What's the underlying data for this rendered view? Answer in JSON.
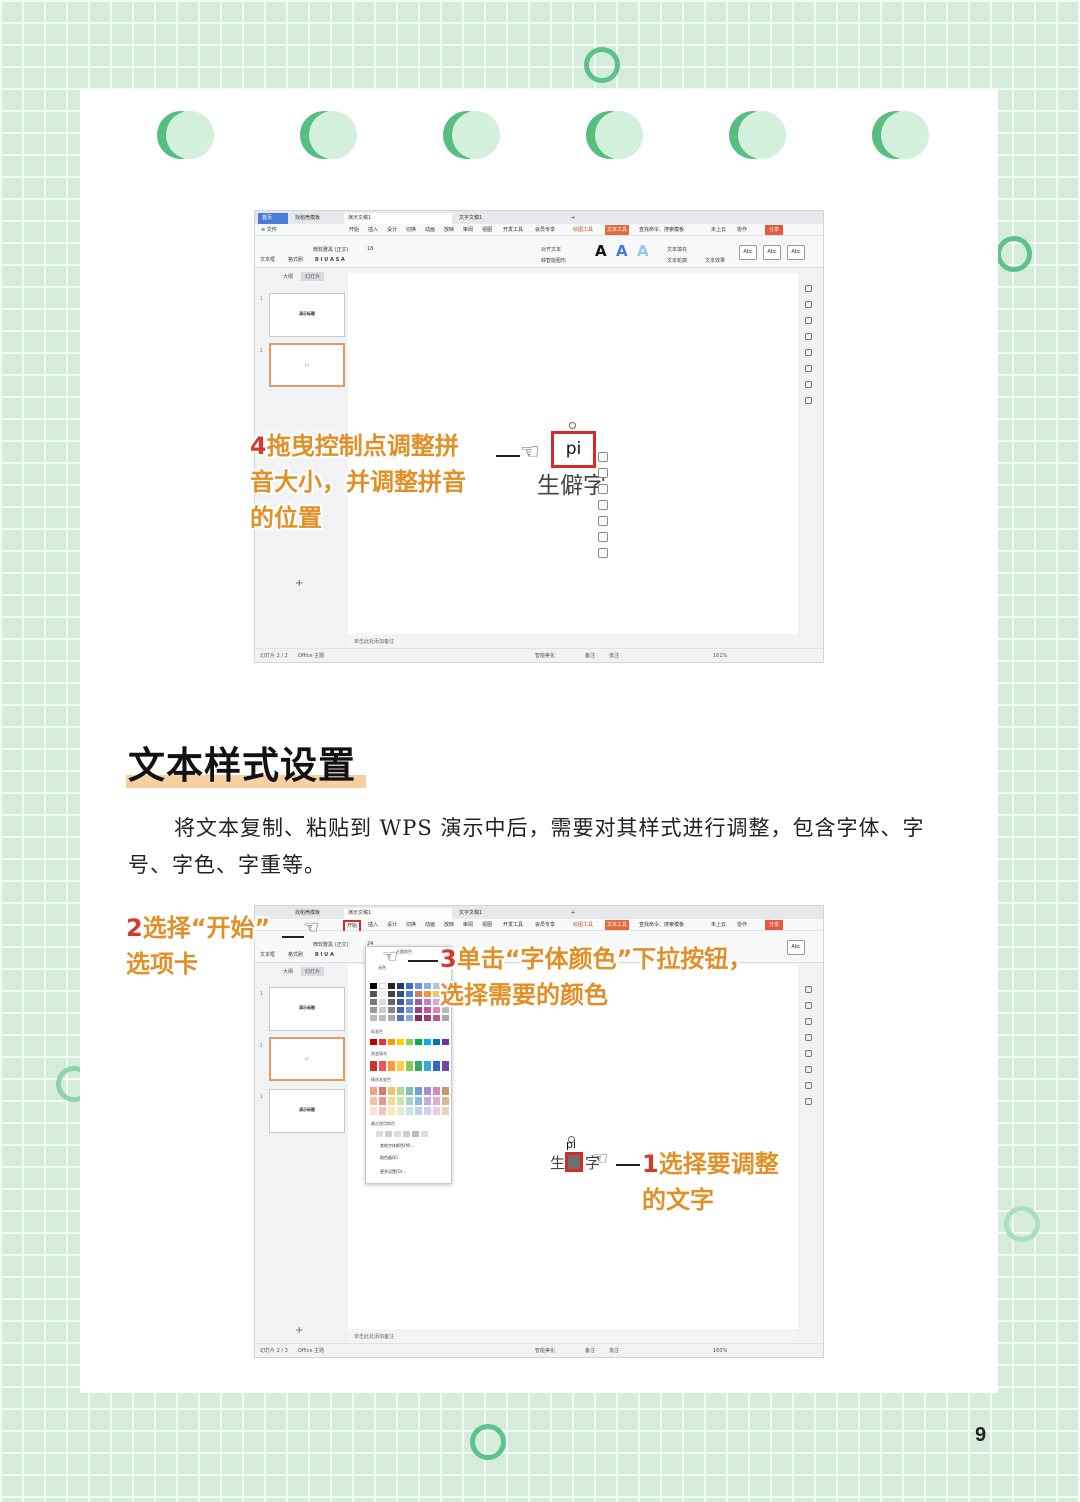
{
  "page_number": "9",
  "section": {
    "heading": "文本样式设置",
    "body": "将文本复制、粘贴到 WPS 演示中后，需要对其样式进行调整，包含字体、字号、字色、字重等。"
  },
  "colors": {
    "background": "#d4ecd9",
    "accent_green": "#5cc38c",
    "annotation_orange": "#e19028",
    "annotation_number_red": "#d33a2c",
    "highlight_red": "#d62a2a",
    "heading_underline": "#f7cfa1"
  },
  "screenshot1": {
    "tabs": [
      "首页",
      "找稻壳模板",
      "演示文稿1",
      "文字文稿1",
      "+"
    ],
    "menu": [
      "≡ 文件",
      "开始",
      "插入",
      "设计",
      "切换",
      "动画",
      "放映",
      "审阅",
      "视图",
      "开发工具",
      "会员专享",
      "绘图工具",
      "文本工具",
      "查找命令、搜索模板",
      "未上云",
      "协作",
      "分享"
    ],
    "ribbon": {
      "textbox": "文本框",
      "format_painter": "格式刷",
      "font_name": "微软雅黑 (正文)",
      "font_size": "18",
      "align_text": "对齐文本",
      "smart_shape": "转智能图形",
      "text_fill": "文本填充",
      "text_outline": "文本轮廓",
      "text_effect": "文本效果",
      "style_sample": "Abc"
    },
    "pane_tabs": [
      "大纲",
      "幻灯片"
    ],
    "slides": [
      {
        "num": "1",
        "title": "演示标题"
      },
      {
        "num": "2",
        "title": "pi"
      }
    ],
    "pinyin": "pi",
    "hanzi": "生僻字",
    "notes": "单击此处添加备注",
    "status": {
      "slide_count": "幻灯片 2 / 2",
      "theme": "Office 主题",
      "beautify": "智能美化",
      "notes_btn": "备注",
      "comments": "批注",
      "zoom": "161%"
    },
    "annotation": {
      "number": "4",
      "line1": "拖曳控制点调整拼",
      "line2": "音大小，并调整拼音",
      "line3": "的位置"
    }
  },
  "screenshot2": {
    "tabs": [
      "找稻壳模板",
      "演示文稿1",
      "文字文稿1",
      "+"
    ],
    "menu": [
      "开始",
      "插入",
      "设计",
      "切换",
      "动画",
      "放映",
      "审阅",
      "视图",
      "开发工具",
      "会员专享",
      "绘图工具",
      "文本工具",
      "查找命令、搜索模板",
      "未上云",
      "协作",
      "分享"
    ],
    "ribbon": {
      "textbox": "文本框",
      "format_painter": "格式刷",
      "font_name": "微软雅黑 (正文)",
      "font_size": "24",
      "style_sample": "Abc"
    },
    "pane_tabs": [
      "大纲",
      "幻灯片"
    ],
    "slides": [
      {
        "num": "1",
        "title": "演示标题"
      },
      {
        "num": "2",
        "title": "pi"
      },
      {
        "num": "3",
        "title": "演示标题"
      }
    ],
    "palette": {
      "no_color": "无色",
      "theme_colors": "主题颜色",
      "standard_colors": "标准色",
      "gradient_fill": "渐变填充",
      "gradient_variants": "精选渐变色",
      "recent_colors": "最近使用颜色",
      "other_colors": "其他字体颜色(M)...",
      "eyedropper": "取色器(E)",
      "more_settings": "更多设置(O)..."
    },
    "pinyin": "pi",
    "hanzi_left": "生",
    "hanzi_right": "字",
    "notes": "单击此处添加备注",
    "status": {
      "slide_count": "幻灯片 2 / 3",
      "theme": "Office 主题",
      "beautify": "智能美化",
      "notes_btn": "备注",
      "comments": "批注",
      "zoom": "160%"
    },
    "annotation_tab": {
      "number": "2",
      "line1": "选择“开始”",
      "line2": "选项卡"
    },
    "annotation_color": {
      "number": "3",
      "line1": "单击“字体颜色”下拉按钮，",
      "line2": "选择需要的颜色"
    },
    "annotation_select": {
      "number": "1",
      "line1": "选择要调整",
      "line2": "的文字"
    }
  }
}
